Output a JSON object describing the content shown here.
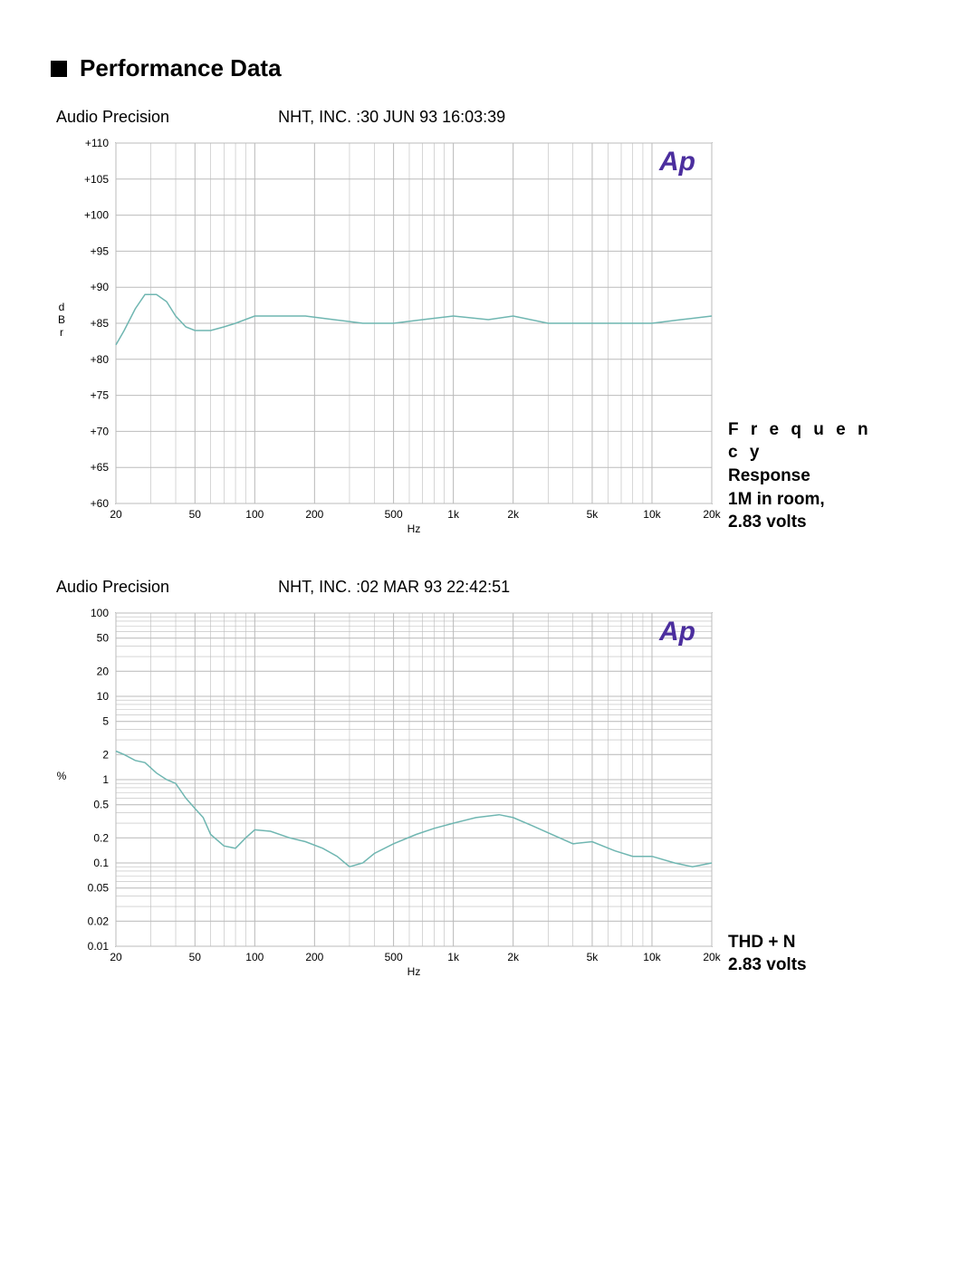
{
  "section_title": "Performance Data",
  "logo_text": "Ap",
  "logo_color": "#4b2e9e",
  "line_color": "#6fb6b1",
  "grid_color": "#bbbbbb",
  "text_color": "#000000",
  "chart1": {
    "header_left": "Audio Precision",
    "header_right": "NHT, INC.   :30 JUN 93  16:03:39",
    "caption_line1": "F r e q u e n c y",
    "caption_line2": "Response",
    "caption_line3": "1M  in  room,",
    "caption_line4": "2.83 volts",
    "ylabel": "d\nB\nr",
    "xlabel": "Hz"
  },
  "chart2": {
    "header_left": "Audio Precision",
    "header_right": "NHT, INC.   :02 MAR 93  22:42:51",
    "caption_line1": "THD + N",
    "caption_line2": "2.83 volts",
    "ylabel": "%",
    "xlabel": "Hz"
  },
  "chart_data": [
    {
      "type": "line",
      "title": "Frequency Response 1M in room, 2.83 volts",
      "xlabel": "Hz",
      "ylabel": "dBr",
      "x_scale": "log",
      "xlim": [
        20,
        20000
      ],
      "ylim": [
        60,
        110
      ],
      "x_ticks": [
        20,
        50,
        100,
        200,
        500,
        1000,
        2000,
        5000,
        10000,
        20000
      ],
      "x_tick_labels": [
        "20",
        "50",
        "100",
        "200",
        "500",
        "1k",
        "2k",
        "5k",
        "10k",
        "20k"
      ],
      "y_ticks": [
        60,
        65,
        70,
        75,
        80,
        85,
        90,
        95,
        100,
        105,
        110
      ],
      "y_tick_labels": [
        "+60",
        "+65",
        "+70",
        "+75",
        "+80",
        "+85",
        "+90",
        "+95",
        "+100",
        "+105",
        "+110"
      ],
      "series": [
        {
          "name": "Frequency Response",
          "x": [
            20,
            22,
            25,
            28,
            32,
            36,
            40,
            45,
            50,
            60,
            70,
            80,
            100,
            130,
            180,
            250,
            350,
            500,
            700,
            1000,
            1500,
            2000,
            3000,
            5000,
            7000,
            10000,
            14000,
            20000
          ],
          "y": [
            82,
            84,
            87,
            89,
            89,
            88,
            86,
            84.5,
            84,
            84,
            84.5,
            85,
            86,
            86,
            86,
            85.5,
            85,
            85,
            85.5,
            86,
            85.5,
            86,
            85,
            85,
            85,
            85,
            85.5,
            86
          ]
        }
      ]
    },
    {
      "type": "line",
      "title": "THD + N, 2.83 volts",
      "xlabel": "Hz",
      "ylabel": "%",
      "x_scale": "log",
      "y_scale": "log",
      "xlim": [
        20,
        20000
      ],
      "ylim": [
        0.01,
        100
      ],
      "x_ticks": [
        20,
        50,
        100,
        200,
        500,
        1000,
        2000,
        5000,
        10000,
        20000
      ],
      "x_tick_labels": [
        "20",
        "50",
        "100",
        "200",
        "500",
        "1k",
        "2k",
        "5k",
        "10k",
        "20k"
      ],
      "y_ticks": [
        0.01,
        0.02,
        0.05,
        0.1,
        0.2,
        0.5,
        1,
        2,
        5,
        10,
        20,
        50,
        100
      ],
      "y_tick_labels": [
        "0.01",
        "0.02",
        "0.05",
        "0.1",
        "0.2",
        "0.5",
        "1",
        "2",
        "5",
        "10",
        "20",
        "50",
        "100"
      ],
      "series": [
        {
          "name": "THD+N",
          "x": [
            20,
            22,
            25,
            28,
            32,
            36,
            40,
            45,
            50,
            55,
            60,
            70,
            80,
            90,
            100,
            120,
            150,
            180,
            220,
            260,
            300,
            350,
            400,
            500,
            650,
            800,
            1000,
            1300,
            1700,
            2000,
            2500,
            3000,
            4000,
            5000,
            6500,
            8000,
            10000,
            13000,
            16000,
            20000
          ],
          "y": [
            2.2,
            2.0,
            1.7,
            1.6,
            1.2,
            1.0,
            0.9,
            0.6,
            0.45,
            0.35,
            0.22,
            0.16,
            0.15,
            0.2,
            0.25,
            0.24,
            0.2,
            0.18,
            0.15,
            0.12,
            0.09,
            0.1,
            0.13,
            0.17,
            0.22,
            0.26,
            0.3,
            0.35,
            0.38,
            0.35,
            0.28,
            0.23,
            0.17,
            0.18,
            0.14,
            0.12,
            0.12,
            0.1,
            0.09,
            0.1
          ]
        }
      ]
    }
  ]
}
